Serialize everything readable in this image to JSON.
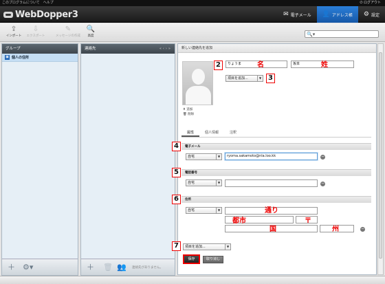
{
  "topbar": {
    "left_text": "このプログラムについて　ヘルプ",
    "logout": "ログアウト"
  },
  "header": {
    "logo": "WebDopper3",
    "tabs": [
      {
        "label": "電子メール",
        "icon": "envelope-icon"
      },
      {
        "label": "アドレス帳",
        "icon": "person-icon",
        "active": true
      },
      {
        "label": "設定",
        "icon": "gear-icon"
      }
    ]
  },
  "toolbar": {
    "buttons": [
      {
        "label": "インポート",
        "icon": "import-icon"
      },
      {
        "label": "エクスポート",
        "icon": "export-icon"
      },
      {
        "label": "メッセージの作成",
        "icon": "compose-icon"
      },
      {
        "label": "高度",
        "icon": "magnifier-icon"
      }
    ]
  },
  "groups_panel": {
    "title": "グループ",
    "items": [
      {
        "label": "個人の住所"
      }
    ]
  },
  "contacts_panel": {
    "title": "連絡先",
    "empty_note": "連絡先がありません。"
  },
  "detail": {
    "header": "新しい連絡先を追加",
    "first_name_value": "りょうま",
    "last_name_value": "坂本",
    "add_field_label": "項目を追加...",
    "photo_add": "追加",
    "photo_delete": "削除",
    "tabs": [
      "属性",
      "個人情報",
      "注釈"
    ],
    "email_section": "電子メール",
    "email_type": "自宅",
    "email_value": "ryoma.sakamoto@nla.loo.kk",
    "phone_section": "電話番号",
    "phone_type": "自宅",
    "address_section": "住所",
    "address_type": "自宅",
    "add_field_bottom": "項目を追加...",
    "save": "保存",
    "cancel": "取り消し"
  },
  "annotations": {
    "markers": [
      "2",
      "3",
      "4",
      "5",
      "6",
      "7"
    ],
    "first_name": "名",
    "last_name": "姓",
    "street": "通り",
    "city": "都市",
    "postal": "〒",
    "country": "国",
    "state": "州"
  },
  "colors": {
    "accent": "#1e6bc4",
    "marker": "#e00000"
  }
}
